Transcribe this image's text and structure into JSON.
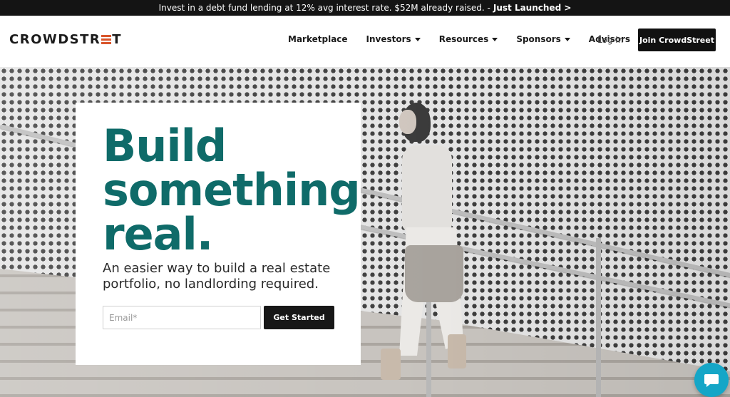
{
  "announcement": {
    "text": "Invest in a debt fund lending at 12% avg interest rate. $52M already raised. -",
    "cta": "Just Launched >"
  },
  "header": {
    "logo_text_left": "CROWDSTR",
    "logo_text_right": "T",
    "nav": [
      {
        "label": "Marketplace",
        "dropdown": false
      },
      {
        "label": "Investors",
        "dropdown": true
      },
      {
        "label": "Resources",
        "dropdown": true
      },
      {
        "label": "Sponsors",
        "dropdown": true
      },
      {
        "label": "Advisors",
        "dropdown": false
      }
    ],
    "login_label": "Log In",
    "join_label": "Join CrowdStreet"
  },
  "hero": {
    "headline": "Build something real.",
    "subheadline": "An easier way to build a real estate portfolio, no landlording required.",
    "email_placeholder": "Email*",
    "email_value": "",
    "cta_label": "Get Started"
  },
  "colors": {
    "brand_teal": "#0f6b69",
    "logo_accent": "#d9552b",
    "chat_blue": "#15a6c7",
    "dark_button": "#111111"
  },
  "icons": {
    "chat": "chat-bubble-icon",
    "caret": "caret-down-icon"
  }
}
